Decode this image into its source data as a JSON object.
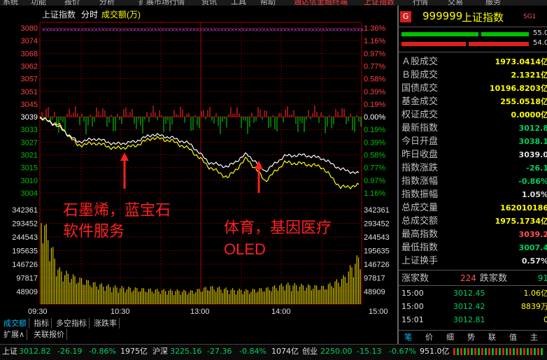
{
  "menubar": {
    "items": [
      "系统",
      "功能",
      "报价",
      "分析",
      "扩展市场行情",
      "资讯",
      "工具",
      "帮助",
      "通达信金融终端",
      "上证指数"
    ],
    "right_items": [
      "行情",
      "交易",
      "服务"
    ]
  },
  "chart": {
    "title": "上证指数",
    "mode": "分时",
    "indicator": "成交额(万)",
    "price_ticks": [
      "3080",
      "3074",
      "3068",
      "3062",
      "3057",
      "3051",
      "3045",
      "3039",
      "3033",
      "3027",
      "3021",
      "3015",
      "3010",
      "3004"
    ],
    "pct_ticks": [
      "1.36%",
      "1.16%",
      "0.97%",
      "0.77%",
      "0.58%",
      "0.39%",
      "0.19%",
      "0.00%",
      "0.19%",
      "0.39%",
      "0.58%",
      "0.77%",
      "0.97%",
      "1.16%"
    ],
    "vol_ticks": [
      "342361",
      "293452",
      "244543",
      "195635",
      "146726",
      "97817",
      "48909"
    ],
    "time_ticks": [
      "09:30",
      "10:30",
      "13:00",
      "14:00",
      "15:00"
    ],
    "annotation_1": {
      "line1": "石墨烯，蓝宝石",
      "line2": "软件服务"
    },
    "annotation_2": {
      "line1": "体育，基因医疗",
      "line2": "OLED"
    },
    "annotation_color": "#ff2020",
    "price_line_color": "#ffffff",
    "avg_line_color": "#ffff00",
    "volume_color": "#d4c400"
  },
  "chart_data": {
    "type": "line",
    "x": [
      "09:30",
      "09:45",
      "10:00",
      "10:15",
      "10:30",
      "10:45",
      "11:00",
      "11:15",
      "11:30",
      "13:00",
      "13:15",
      "13:30",
      "13:45",
      "14:00",
      "14:15",
      "14:30",
      "14:45",
      "15:00"
    ],
    "series": [
      {
        "values": [
          3039.0,
          3034.5,
          3027.5,
          3029.0,
          3026.5,
          3027.5,
          3031.0,
          3029.5,
          3026.5,
          3018.0,
          3016.0,
          3022.0,
          3014.0,
          3021.0,
          3021.5,
          3020.0,
          3015.0,
          3012.8
        ]
      },
      {
        "values": [
          3038.5,
          3035.5,
          3026.0,
          3027.0,
          3024.5,
          3025.5,
          3029.5,
          3028.0,
          3024.0,
          3016.0,
          3011.0,
          3020.0,
          3009.5,
          3018.0,
          3017.5,
          3016.0,
          3006.5,
          3007.5
        ]
      }
    ],
    "volume": [
      330000,
      120000,
      90000,
      70000,
      60000,
      55000,
      50000,
      48000,
      45000,
      60000,
      52000,
      48000,
      55000,
      70000,
      65000,
      60000,
      90000,
      180000
    ],
    "ylim": [
      3001,
      3082
    ],
    "ylim_volume": [
      0,
      380000
    ]
  },
  "quote": {
    "badge": "G",
    "code": "999999",
    "name": "上证指数",
    "tag": "SG1",
    "bar1_value": "55.0",
    "bar2_value": "45.0",
    "bar2b_value": "54.0",
    "rows": [
      {
        "label": "Ａ股成交",
        "value": "1973.0414亿",
        "color": "yl"
      },
      {
        "label": "Ｂ股成交",
        "value": "2.1321亿",
        "color": "yl"
      },
      {
        "label": "国债成交",
        "value": "10196.8203亿",
        "color": "yl"
      },
      {
        "label": "基金成交",
        "value": "255.0518亿",
        "color": "yl"
      },
      {
        "label": "权证成交",
        "value": "0.0000亿",
        "color": "yl"
      },
      {
        "label": "最新指数",
        "value": "3012.8",
        "color": "down"
      },
      {
        "label": "今日开盘",
        "value": "3038.1",
        "color": "down"
      },
      {
        "label": "昨日收盘",
        "value": "3039.0",
        "color": "wh"
      },
      {
        "label": "指数涨跌",
        "value": "-26.1",
        "color": "down"
      },
      {
        "label": "指数涨幅",
        "value": "-0.86%",
        "color": "down"
      },
      {
        "label": "指数振幅",
        "value": "1.05%",
        "color": "wh"
      },
      {
        "label": "总成交量",
        "value": "162010186",
        "color": "yl"
      },
      {
        "label": "总成交额",
        "value": "1975.1734亿",
        "color": "yl"
      },
      {
        "label": "最高指数",
        "value": "3039.2",
        "color": "up"
      },
      {
        "label": "最低指数",
        "value": "3007.4",
        "color": "down"
      },
      {
        "label": "上证换手",
        "value": "0.57%",
        "color": "wh"
      }
    ],
    "up_label": "涨家数",
    "up_count": "224",
    "down_label": "跌家数",
    "down_count": "91",
    "ticks": [
      {
        "time": "15:00",
        "price": "3012.45",
        "vol": "1.06亿"
      },
      {
        "time": "15:00",
        "price": "3012.42",
        "vol": "8839万"
      },
      {
        "time": "15:01",
        "price": "3012.81",
        "vol": "0"
      }
    ],
    "bottom_tabs": [
      "笔",
      "价",
      "细",
      "势",
      "联",
      "值",
      "主"
    ]
  },
  "tabs": {
    "main": [
      "成交额",
      "指标",
      "多空指标",
      "涨跌率"
    ],
    "sub": [
      "扩展∧",
      "关联报价"
    ]
  },
  "status": {
    "sh_label": "上证",
    "sh_value": "3012.82",
    "sh_change": "-26.19",
    "sh_pct": "-0.86%",
    "sh_amount": "1975亿",
    "hs_label": "沪深",
    "hs_value": "3225.16",
    "hs_change": "-27.36",
    "hs_pct": "-0.84%",
    "hs_amount": "1074亿",
    "cy_label": "创业",
    "cy_value": "2250.00",
    "cy_change": "-15.13",
    "cy_pct": "-0.67%",
    "cy_amount": "951.0亿"
  }
}
